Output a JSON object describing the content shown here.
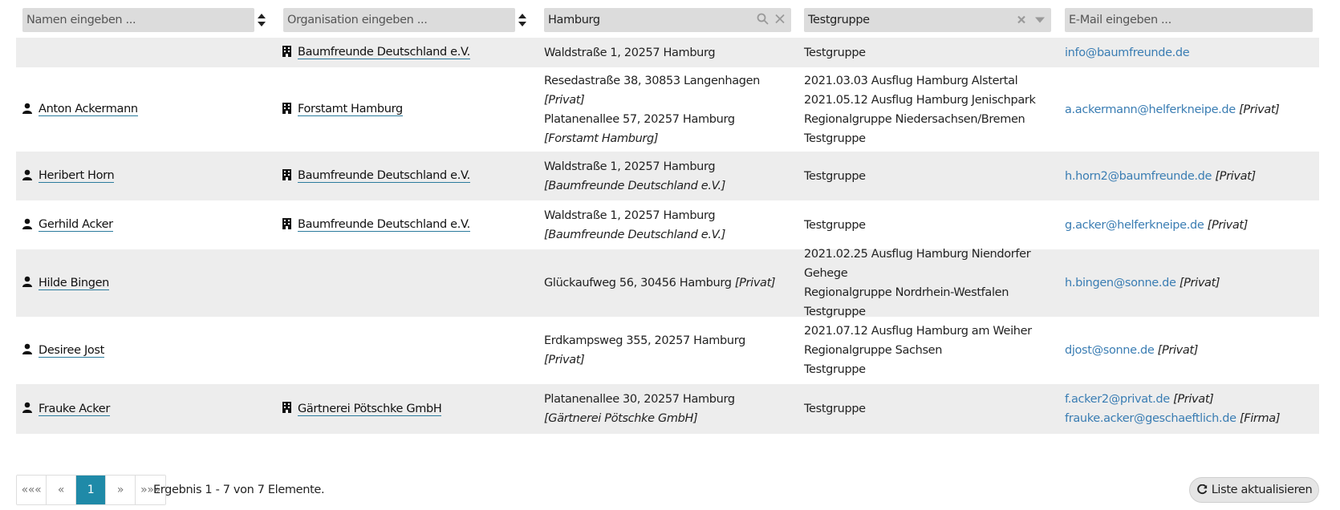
{
  "filters": {
    "name_placeholder": "Namen eingeben ...",
    "org_placeholder": "Organisation eingeben ...",
    "address_value": "Hamburg",
    "group_value": "Testgruppe",
    "email_placeholder": "E-Mail eingeben ..."
  },
  "rows": [
    {
      "name": "",
      "org": "Baumfreunde Deutschland e.V.",
      "addresses": [
        {
          "text": "Waldstraße 1, 20257 Hamburg",
          "tag": ""
        }
      ],
      "groups": [
        "Testgruppe"
      ],
      "emails": [
        {
          "address": "info@baumfreunde.de",
          "tag": ""
        }
      ]
    },
    {
      "name": "Anton Ackermann",
      "org": "Forstamt Hamburg",
      "addresses": [
        {
          "text": "Resedastraße 38, 30853 Langenhagen",
          "tag": "[Privat]"
        },
        {
          "text": "Platanenallee 57, 20257 Hamburg",
          "tag": "[Forstamt Hamburg]"
        }
      ],
      "groups": [
        "2021.03.03 Ausflug Hamburg Alstertal",
        "2021.05.12 Ausflug Hamburg Jenischpark",
        "Regionalgruppe Niedersachsen/Bremen",
        "Testgruppe"
      ],
      "emails": [
        {
          "address": "a.ackermann@helferkneipe.de",
          "tag": "[Privat]"
        }
      ]
    },
    {
      "name": "Heribert Horn",
      "org": "Baumfreunde Deutschland e.V.",
      "addresses": [
        {
          "text": "Waldstraße 1, 20257 Hamburg",
          "tag": "[Baumfreunde Deutschland e.V.]"
        }
      ],
      "groups": [
        "Testgruppe"
      ],
      "emails": [
        {
          "address": "h.horn2@baumfreunde.de",
          "tag": "[Privat]"
        }
      ]
    },
    {
      "name": "Gerhild Acker",
      "org": "Baumfreunde Deutschland e.V.",
      "addresses": [
        {
          "text": "Waldstraße 1, 20257 Hamburg",
          "tag": "[Baumfreunde Deutschland e.V.]"
        }
      ],
      "groups": [
        "Testgruppe"
      ],
      "emails": [
        {
          "address": "g.acker@helferkneipe.de",
          "tag": "[Privat]"
        }
      ]
    },
    {
      "name": "Hilde Bingen",
      "org": "",
      "addresses": [
        {
          "text": "Glückaufweg 56, 30456 Hamburg",
          "tag": "[Privat]"
        }
      ],
      "groups": [
        "2021.02.25 Ausflug Hamburg Niendorfer Gehege",
        "Regionalgruppe Nordrhein-Westfalen",
        "Testgruppe"
      ],
      "emails": [
        {
          "address": "h.bingen@sonne.de",
          "tag": "[Privat]"
        }
      ]
    },
    {
      "name": "Desiree Jost",
      "org": "",
      "addresses": [
        {
          "text": "Erdkampsweg 355, 20257 Hamburg",
          "tag": "[Privat]"
        }
      ],
      "groups": [
        "2021.07.12 Ausflug Hamburg am Weiher",
        "Regionalgruppe Sachsen",
        "Testgruppe"
      ],
      "emails": [
        {
          "address": "djost@sonne.de",
          "tag": "[Privat]"
        }
      ]
    },
    {
      "name": "Frauke Acker",
      "org": "Gärtnerei Pötschke GmbH",
      "addresses": [
        {
          "text": "Platanenallee 30, 20257 Hamburg",
          "tag": "[Gärtnerei Pötschke GmbH]"
        }
      ],
      "groups": [
        "Testgruppe"
      ],
      "emails": [
        {
          "address": "f.acker2@privat.de",
          "tag": "[Privat]"
        },
        {
          "address": "frauke.acker@geschaeftlich.de",
          "tag": "[Firma]"
        }
      ]
    }
  ],
  "pager": {
    "first": "«««",
    "prev": "«",
    "current": "1",
    "next": "»",
    "last": "»»»",
    "result_text": "Ergebnis 1 - 7 von 7 Elemente."
  },
  "refresh_label": "Liste aktualisieren",
  "colors": {
    "accent": "#1f8aa8",
    "link": "#3a7db3",
    "row_alt": "#ededed",
    "filter_bg": "#dcdcdc"
  }
}
